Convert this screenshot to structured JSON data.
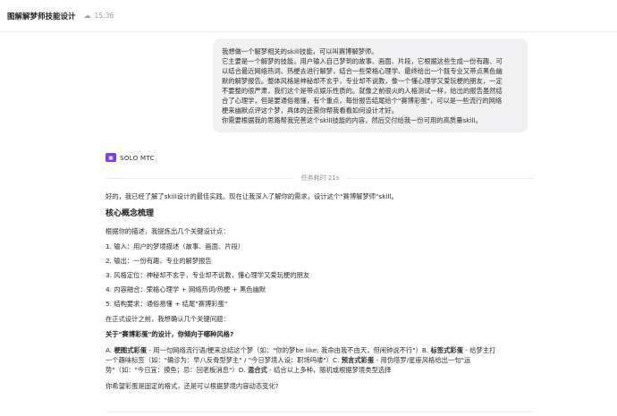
{
  "header": {
    "title": "图解解梦师技能设计",
    "time": "15:36"
  },
  "user_message": {
    "lines": [
      "我想做一个解梦相关的skill技能，可以叫赛博解梦师。",
      "它主要是一个解梦的技能，用户输入自己梦到的故事、画面、片段，它根据这些生成一份有趣、可",
      "以结合最近网络热词、热梗去进行解梦，结合一些荣格心理学、最终给出一个既专业又带点黑色幽",
      "默的解梦报告。整体风格是神秘却不玄乎，专业却不说教，像一个懂心理学又爱玩梗的朋友，一定",
      "不要整的很严肃，我们这个是带点娱乐性质的。就像之前很火的人格测试一样，给出的报告虽然结",
      "合了心理学，但是要通俗易懂，有个重点，每份报告结尾给个\"赛博彩蛋\"，可以是一些流行的网络",
      "梗来幽默点评这个梦，具体的还需你帮我看看如何设计才好。",
      "你需要根据我的思路帮我完善这个skill技能的内容，然后交付给我一份可用的高质量skill。"
    ]
  },
  "assistant": {
    "name": "SOLO MTC",
    "badge": "▣",
    "divider": "任务耗时 21s",
    "intro": "好的，我已经了解了skill设计的最佳实践。现在让我深入了解你的需求，设计这个\"赛博解梦师\"skill。",
    "section_title": "核心概念梳理",
    "analysis_intro": "根据你的描述，我提炼出几个关键设计点：",
    "points": [
      "1. 输入：用户的梦境描述（故事、画面、片段）",
      "2. 输出：一份有趣、专业的解梦报告",
      "3. 风格定位：神秘却不玄乎，专业却不说教，懂心理学又爱玩梗的朋友",
      "4. 内容融合：荣格心理学 + 网络热词/热梗 + 黑色幽默",
      "5. 结构要求：通俗易懂 + 结尾\"赛博彩蛋\""
    ],
    "before_design": "在正式设计之前，我想确认几个关键问题：",
    "question_title": "关于\"赛博彩蛋\"的设计，你倾向于哪种风格?",
    "options_line_1_prefix": "A. ",
    "options_line_1_bold_1": "梗图式彩蛋",
    "options_line_1_rest": " - 用一句网络流行语/梗来总结这个梦（如：\"你的梦be like: 我命由我不由天，但闹钟说不行\"）B. ",
    "options_line_1_bold_2": "标签式彩蛋",
    "options_line_1_rest_2": " - 给梦主打",
    "options_line_2_prefix": "一个趣味标签（如：\"确诊为：早八反骨型梦主\" / \"今日梦境人设：职场吗喽\"）C. ",
    "options_line_2_bold": "预言式彩蛋",
    "options_line_2_rest": " - 用伪塔罗/星座风格给出一句\"运",
    "options_line_3_prefix": "势\"（如：\"今日宜：摸鱼；忌：回老板消息\"）D. ",
    "options_line_3_bold": "混合式",
    "options_line_3_rest": " - 结合以上多种，随机或根据梦境类型选择",
    "final_question": "你希望彩蛋是固定的格式，还是可以根据梦境内容动态变化?"
  }
}
